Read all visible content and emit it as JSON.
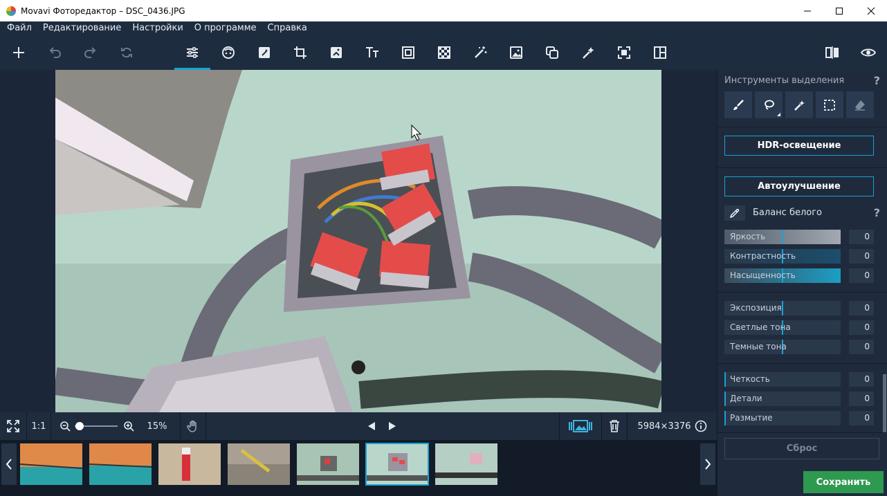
{
  "window": {
    "title": "Movavi Фоторедактор – DSC_0436.JPG"
  },
  "menu": [
    "Файл",
    "Редактирование",
    "Настройки",
    "О программе",
    "Справка"
  ],
  "toolbar": {
    "left_icons": [
      "plus-icon",
      "undo-icon",
      "redo-icon",
      "refresh-icon"
    ],
    "tools": [
      "adjust-sliders-icon",
      "retouch-face-icon",
      "magic-enhance-icon",
      "crop-icon",
      "filters-icon",
      "text-icon",
      "frames-icon",
      "background-remove-icon",
      "object-removal-icon",
      "replace-background-icon",
      "clone-stamp-icon",
      "selection-magic-icon",
      "resize-icon",
      "layout-icon"
    ],
    "active_tool": "adjust-sliders-icon",
    "right_icons": [
      "compare-icon",
      "eye-icon"
    ]
  },
  "bottom_bar": {
    "zoom_ratio": "1:1",
    "zoom_percent": "15%",
    "zoom_level": 0.02,
    "image_size": "5984×3376"
  },
  "filmstrip": {
    "selected_index": 5,
    "count": 7
  },
  "panel": {
    "selection_title": "Инструменты выделения",
    "help": "?",
    "hdr_label": "HDR-освещение",
    "auto_label": "Автоулучшение",
    "white_balance_label": "Баланс белого",
    "groups": [
      [
        {
          "label": "Яркость",
          "value": "0"
        },
        {
          "label": "Контрастность",
          "value": "0"
        },
        {
          "label": "Насыщенность",
          "value": "0"
        }
      ],
      [
        {
          "label": "Экспозиция",
          "value": "0"
        },
        {
          "label": "Светлые тона",
          "value": "0"
        },
        {
          "label": "Темные тона",
          "value": "0"
        }
      ],
      [
        {
          "label": "Четкость",
          "value": "0"
        },
        {
          "label": "Детали",
          "value": "0"
        },
        {
          "label": "Размытие",
          "value": "0"
        }
      ]
    ],
    "reset_label": "Сброс",
    "save_label": "Сохранить"
  },
  "colors": {
    "accent": "#18a2d4",
    "save": "#2e9a4f",
    "panel_bg": "#1f2b3c"
  }
}
